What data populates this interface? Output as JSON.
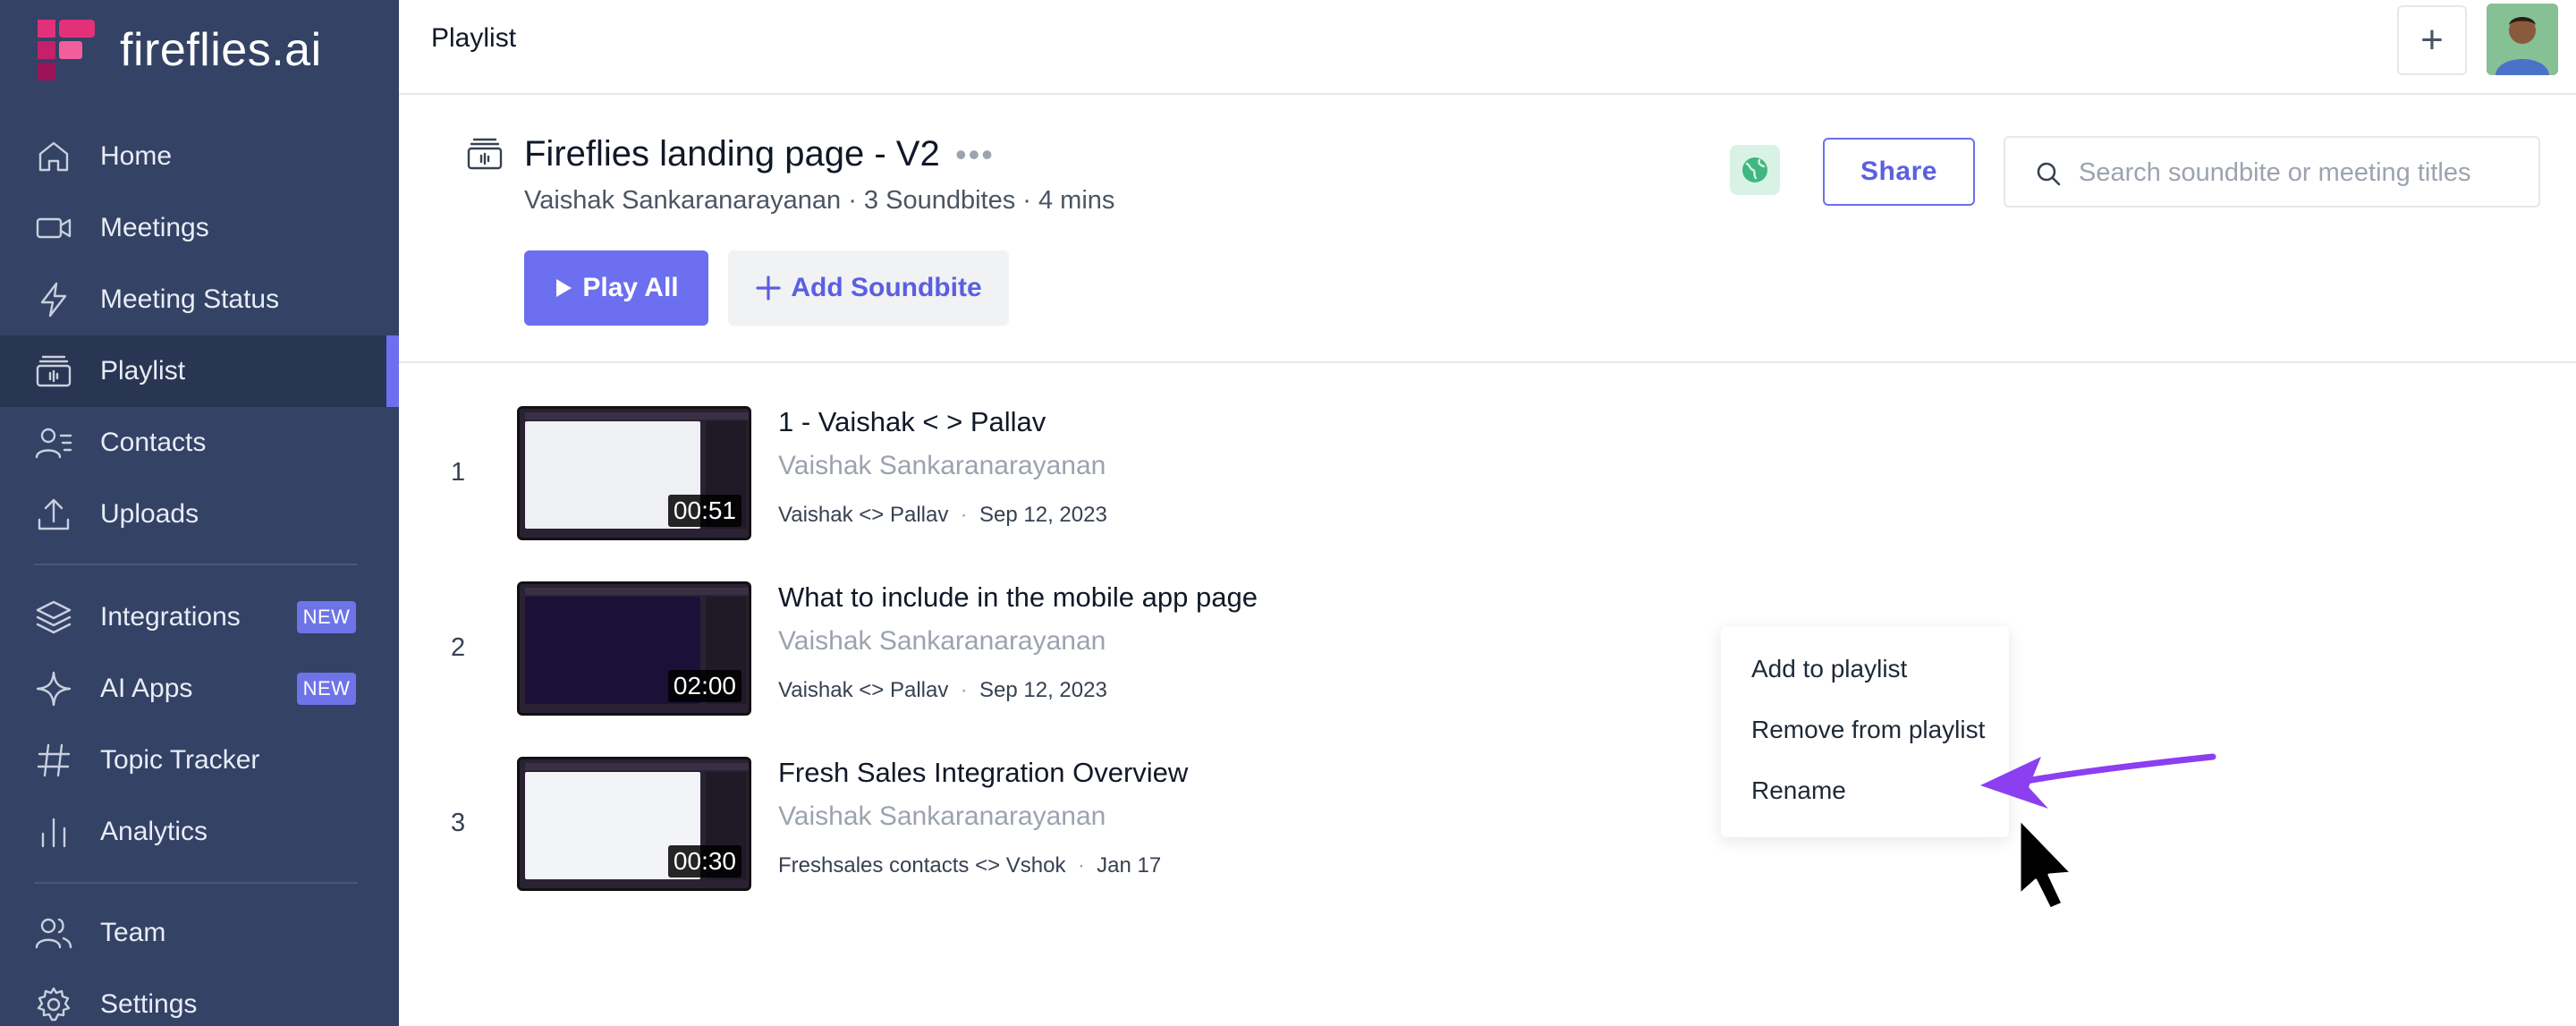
{
  "app": {
    "logo_text": "fireflies.ai",
    "colors": {
      "sidebar": "#334265",
      "accent": "#6b6ff0",
      "arrow": "#8b3ff0"
    }
  },
  "sidebar": {
    "items": [
      {
        "label": "Home",
        "icon": "home-icon"
      },
      {
        "label": "Meetings",
        "icon": "video-icon"
      },
      {
        "label": "Meeting Status",
        "icon": "lightning-icon"
      },
      {
        "label": "Playlist",
        "icon": "playlist-icon",
        "active": true
      },
      {
        "label": "Contacts",
        "icon": "contacts-icon"
      },
      {
        "label": "Uploads",
        "icon": "upload-icon"
      },
      {
        "label": "Integrations",
        "icon": "layers-icon",
        "badge": "NEW"
      },
      {
        "label": "AI Apps",
        "icon": "sparkle-icon",
        "badge": "NEW"
      },
      {
        "label": "Topic Tracker",
        "icon": "hash-icon"
      },
      {
        "label": "Analytics",
        "icon": "bar-chart-icon"
      },
      {
        "label": "Team",
        "icon": "team-icon"
      },
      {
        "label": "Settings",
        "icon": "gear-icon"
      }
    ]
  },
  "topbar": {
    "title": "Playlist",
    "add_label": "+"
  },
  "playlist": {
    "title": "Fireflies landing page - V2",
    "more": "•••",
    "meta": "Vaishak Sankaranarayanan · 3 Soundbites · 4 mins",
    "share_label": "Share",
    "search_placeholder": "Search soundbite or meeting titles",
    "play_all_label": "Play All",
    "add_soundbite_label": "Add Soundbite"
  },
  "soundbites": [
    {
      "num": "1",
      "title": "1 - Vaishak < > Pallav",
      "owner": "Vaishak Sankaranarayanan",
      "meeting": "Vaishak <> Pallav",
      "date": "Sep 12, 2023",
      "duration": "00:51"
    },
    {
      "num": "2",
      "title": "What to include in the mobile app page",
      "owner": "Vaishak Sankaranarayanan",
      "meeting": "Vaishak <> Pallav",
      "date": "Sep 12, 2023",
      "duration": "02:00"
    },
    {
      "num": "3",
      "title": "Fresh Sales Integration Overview",
      "owner": "Vaishak Sankaranarayanan",
      "meeting": "Freshsales contacts <> Vshok",
      "date": "Jan 17",
      "duration": "00:30"
    }
  ],
  "context_menu": {
    "items": [
      "Add to playlist",
      "Remove from playlist",
      "Rename"
    ]
  }
}
